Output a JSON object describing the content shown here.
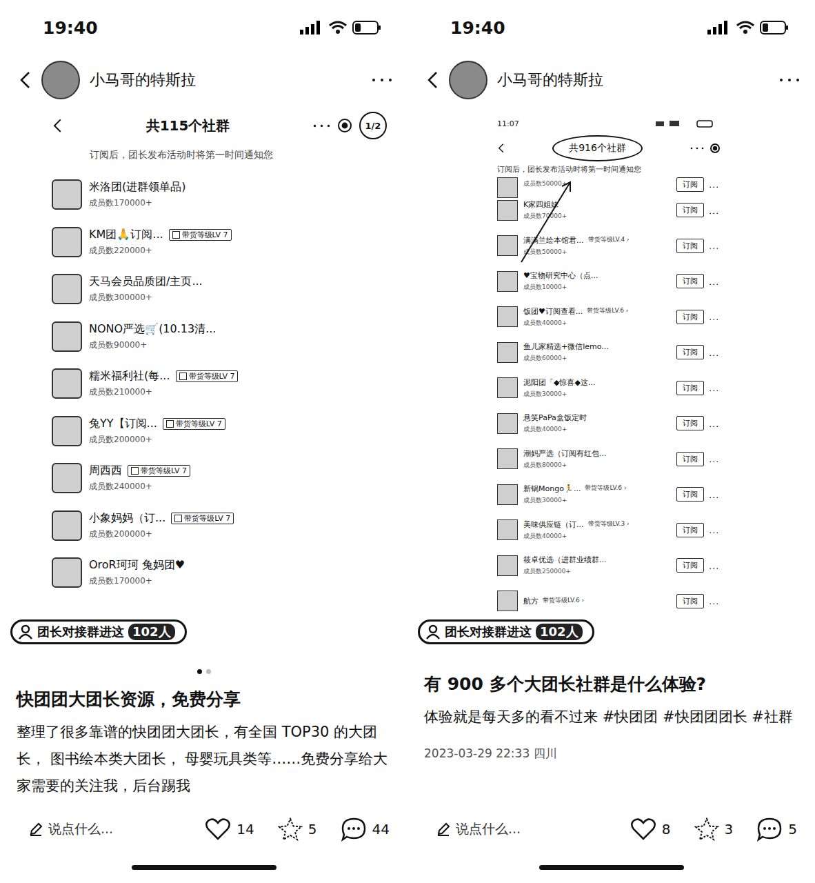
{
  "panels": [
    {
      "kind": "gallery",
      "time": "19:40",
      "author": "小马哥的特斯拉",
      "embed": {
        "title": "共115个社群",
        "page": "1/2",
        "subtitle": "订阅后，团长发布活动时将第一时间通知您",
        "items": [
          {
            "name": "米洛团(进群领单品)",
            "level": null,
            "members": "成员数170000+"
          },
          {
            "name": "KM团🙏订阅...",
            "level": "带货等级LV 7",
            "members": "成员数220000+"
          },
          {
            "name": "天马会员品质团/主页...",
            "level": null,
            "members": "成员数300000+"
          },
          {
            "name": "NONO严选🛒(10.13清...",
            "level": null,
            "members": "成员数90000+"
          },
          {
            "name": "糯米福利社(每...",
            "level": "带货等级LV 7",
            "members": "成员数210000+"
          },
          {
            "name": "兔YY【订阅...",
            "level": "带货等级LV 7",
            "members": "成员数200000+"
          },
          {
            "name": "周西西",
            "level": "带货等级LV 7",
            "members": "成员数240000+"
          },
          {
            "name": "小象妈妈（订...",
            "level": "带货等级LV 7",
            "members": "成员数200000+"
          },
          {
            "name": "OroR珂珂 兔妈团♥",
            "level": null,
            "members": "成员数170000+"
          }
        ]
      },
      "tag": {
        "label": "团长对接群进这",
        "count": "102人"
      },
      "dots": [
        {
          "selected": true
        },
        {
          "selected": false
        }
      ],
      "post": {
        "title": "快团团大团长资源，免费分享",
        "body": "整理了很多靠谱的快团团大团长，有全国 TOP30 的大团长， 图书绘本类大团长，  母婴玩具类等……免费分享给大家需要的关注我，后台踢我",
        "date": null
      },
      "actions": {
        "input": "说点什么...",
        "likes": "14",
        "stars": "5",
        "comments": "44"
      }
    },
    {
      "kind": "subscribe",
      "time": "19:40",
      "author": "小马哥的特斯拉",
      "embed": {
        "time": "11:07",
        "title": "共916个社群",
        "subtitle": "订阅后，团长发布活动时将第一时间通知您",
        "items": [
          {
            "name": "",
            "level": null,
            "members": "成员数50000+",
            "button": "订阅"
          },
          {
            "name": "K家四姐妹",
            "level": null,
            "members": "成员数70000+",
            "button": "订阅"
          },
          {
            "name": "满满兰绘本馆君...",
            "level": "带货等级LV.4 ›",
            "members": "成员数50000+",
            "button": "订阅"
          },
          {
            "name": "♥宝物研究中心（点...",
            "level": null,
            "members": "成员数10000+",
            "button": "订阅"
          },
          {
            "name": "饭团♥订阅查看...",
            "level": "带货等级LV.6 ›",
            "members": "成员数40000+",
            "button": "订阅"
          },
          {
            "name": "鱼儿家精选+微信lemo...",
            "level": null,
            "members": "成员数60000+",
            "button": "订阅"
          },
          {
            "name": "泥阳团「◆惊喜◆这...",
            "level": null,
            "members": "成员数30000+",
            "button": "订阅"
          },
          {
            "name": "悬笑PaPa盒饭定时",
            "level": null,
            "members": "成员数40000+",
            "button": "订阅"
          },
          {
            "name": "潮妈严选（订阅有红包...",
            "level": null,
            "members": "成员数80000+",
            "button": "订阅"
          },
          {
            "name": "新锅Mongo🏃...",
            "level": "带货等级LV.6 ›",
            "members": "成员数30000+",
            "button": "订阅"
          },
          {
            "name": "美味供应链（订...",
            "level": "带货等级LV.3 ›",
            "members": "成员数40000+",
            "button": "订阅"
          },
          {
            "name": "筱卓优选（进群业绩群...",
            "level": null,
            "members": "成员数250000+",
            "button": "订阅"
          },
          {
            "name": "航方",
            "level": "带货等级LV.6 ›",
            "members": "",
            "button": "订阅"
          }
        ]
      },
      "tag": {
        "label": "团长对接群进这",
        "count": "102人"
      },
      "dots": [],
      "post": {
        "title": "有 900 多个大团长社群是什么体验?",
        "body": "体验就是每天多的看不过来 #快团团  #快团团团长  #社群",
        "date": "2023-03-29 22:33 四川"
      },
      "actions": {
        "input": "说点什么...",
        "likes": "8",
        "stars": "3",
        "comments": "5"
      }
    }
  ]
}
